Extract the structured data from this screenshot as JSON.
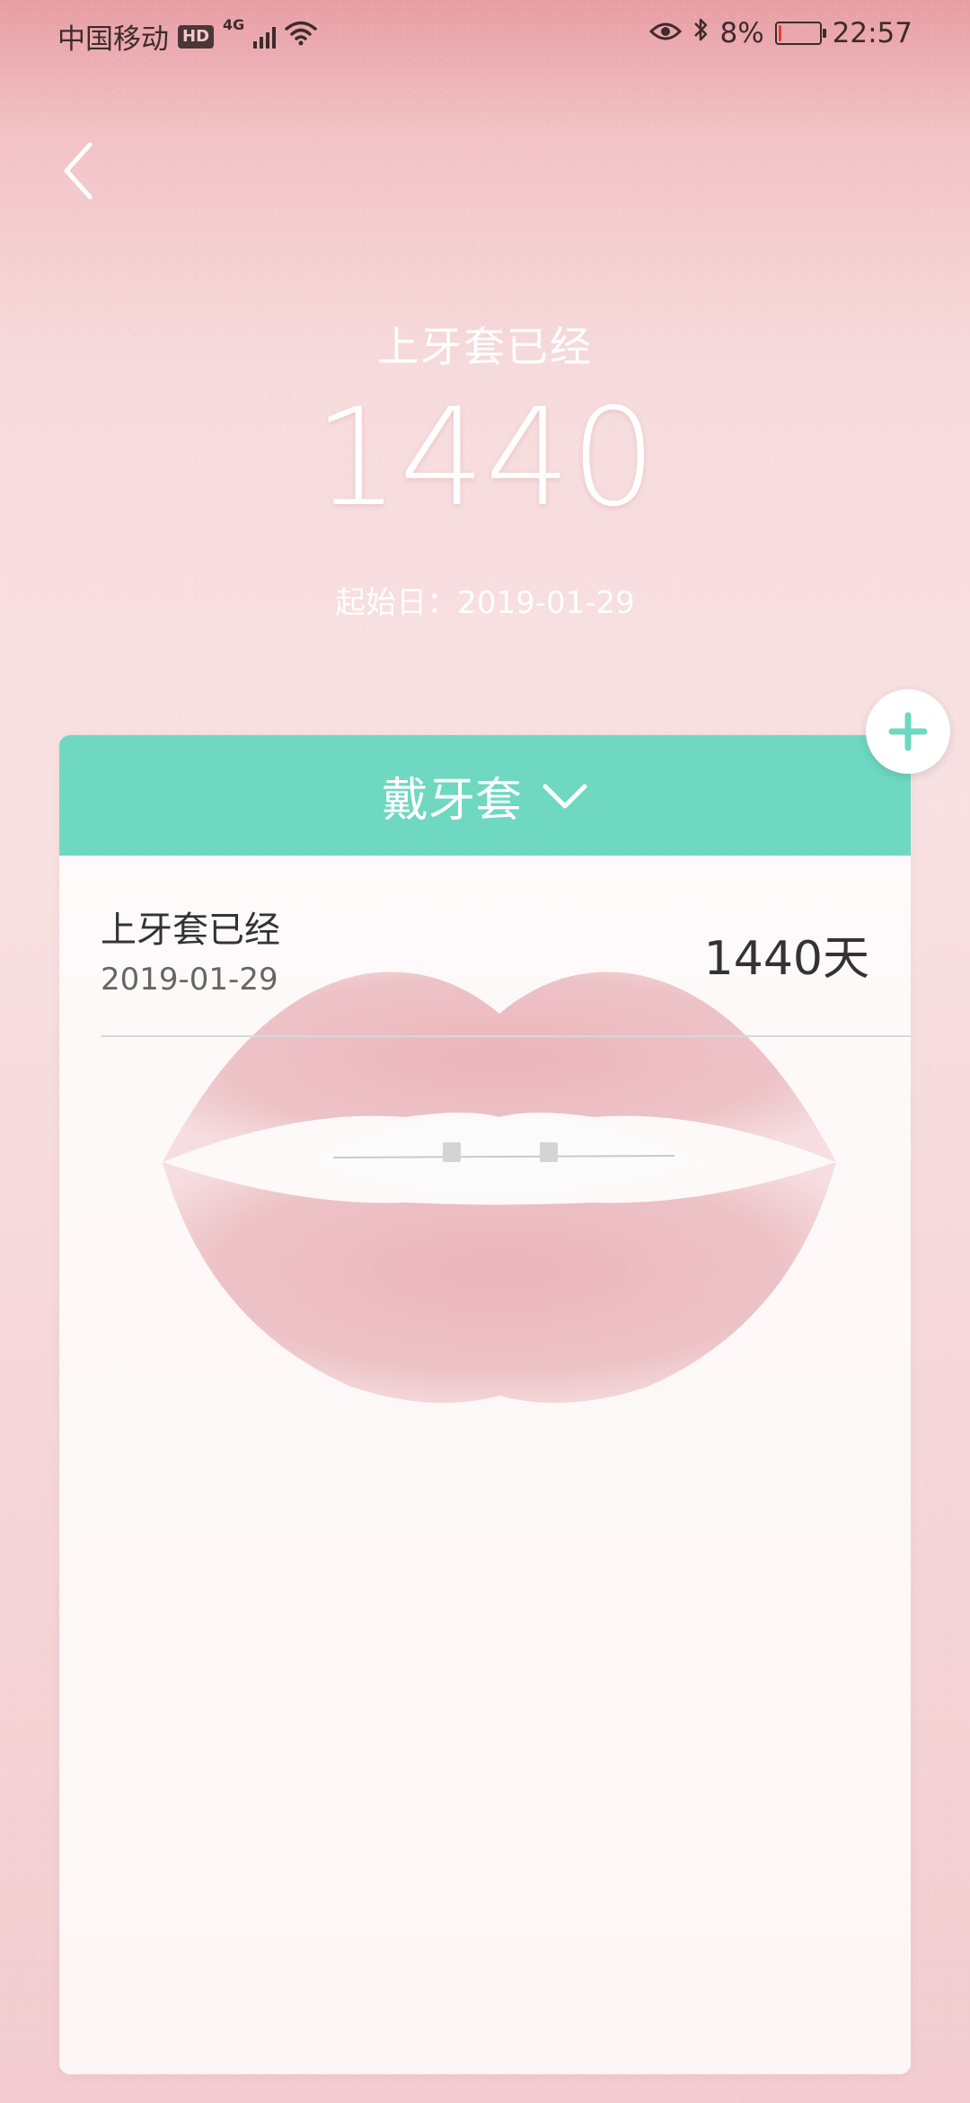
{
  "status_bar": {
    "carrier": "中国移动",
    "hd_badge": "HD",
    "network": "4G",
    "battery_percent": "8%",
    "battery_level": 0.08,
    "time": "22:57"
  },
  "header": {
    "title": "上牙套已经",
    "count": "1440",
    "start_label": "起始日：2019-01-29"
  },
  "card": {
    "category": "戴牙套",
    "items": [
      {
        "title": "上牙套已经",
        "date": "2019-01-29",
        "days": "1440天"
      }
    ]
  },
  "colors": {
    "accent": "#6ed8c0",
    "battery_low": "#e13c3c"
  },
  "icons": {
    "back": "chevron-left-icon",
    "dropdown": "chevron-down-icon",
    "add": "plus-icon"
  }
}
